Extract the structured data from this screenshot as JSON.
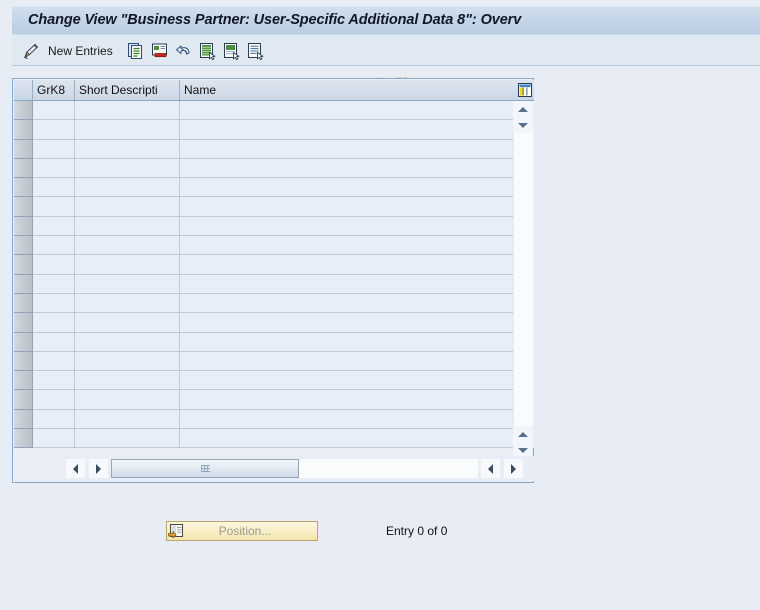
{
  "window": {
    "title": "Change View \"Business Partner: User-Specific Additional Data 8\": Overv"
  },
  "toolbar": {
    "new_entries_label": "New Entries",
    "icons": [
      {
        "name": "pencil-display-change-icon",
        "title": "Display/Change"
      },
      {
        "name": "copy-as-icon",
        "title": "Copy As..."
      },
      {
        "name": "delete-icon",
        "title": "Delete"
      },
      {
        "name": "undo-icon",
        "title": "Undo Change"
      },
      {
        "name": "select-all-icon",
        "title": "Select All"
      },
      {
        "name": "deselect-all-icon",
        "title": "Deselect All"
      },
      {
        "name": "variable-list-icon",
        "title": "Variable List"
      }
    ],
    "watermark": "www.tutorialkart.com"
  },
  "table": {
    "settings_icon": "table-settings-icon",
    "columns": [
      {
        "key": "select",
        "label": ""
      },
      {
        "key": "grk8",
        "label": "GrK8"
      },
      {
        "key": "short_description",
        "label": "Short Descripti"
      },
      {
        "key": "name",
        "label": "Name"
      }
    ],
    "rows": [],
    "visible_row_count": 18,
    "vertical_scrollbar": {
      "up_top": "scroll-up-icon",
      "down_top": "scroll-down-icon",
      "up_bottom": "scroll-up-icon",
      "down_bottom": "scroll-down-icon"
    },
    "horizontal_scrollbar": {
      "left": "scroll-left-icon",
      "right": "scroll-right-icon",
      "grip": "scroll-thumb-grip"
    }
  },
  "footer": {
    "position_button_label": "Position...",
    "position_button_icon": "position-icon",
    "position_button_enabled": false,
    "entry_status": "Entry 0 of 0"
  },
  "colors": {
    "background": "#e8edf5",
    "titlebar": "#c3d5e8",
    "frame_border": "#8ba7c4",
    "grid_cell": "#e8eef7",
    "row_selector": "#c6ccd4",
    "button_yellow": "#f7eec4",
    "watermark": "#f2c49b"
  }
}
